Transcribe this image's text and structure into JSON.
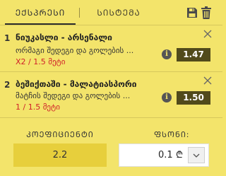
{
  "tabs": {
    "active_label": "ᲔᲥᲡᲞᲠᲔᲡᲘ",
    "other_label": "ᲡᲘᲡᲢᲔᲛᲐ"
  },
  "bets": [
    {
      "index": "1",
      "title": "ნიუკასლი - არსენალი",
      "market": "ორმაგი შედეგი და გოლების ...",
      "pick": "X2 / 1.5 მეტი",
      "odds": "1.47"
    },
    {
      "index": "2",
      "title": "ბეშიქთაში - მალატიასპორი",
      "market": "მატჩის შედეგი და გოლების ...",
      "pick": "1 / 1.5 მეტი",
      "odds": "1.50"
    }
  ],
  "footer": {
    "coef_label": "ᲙᲝᲔᲤᲘᲪᲘᲔᲜᲢᲘ",
    "coef_value": "2.2",
    "stake_label": "ᲤᲡᲝᲜᲘ:",
    "stake_value": "0.1",
    "currency": "₾"
  },
  "colors": {
    "background": "#f3e46b",
    "odds_box": "#514a1b",
    "pick_text": "#d0202a",
    "coef_box": "#e7cf3c"
  }
}
